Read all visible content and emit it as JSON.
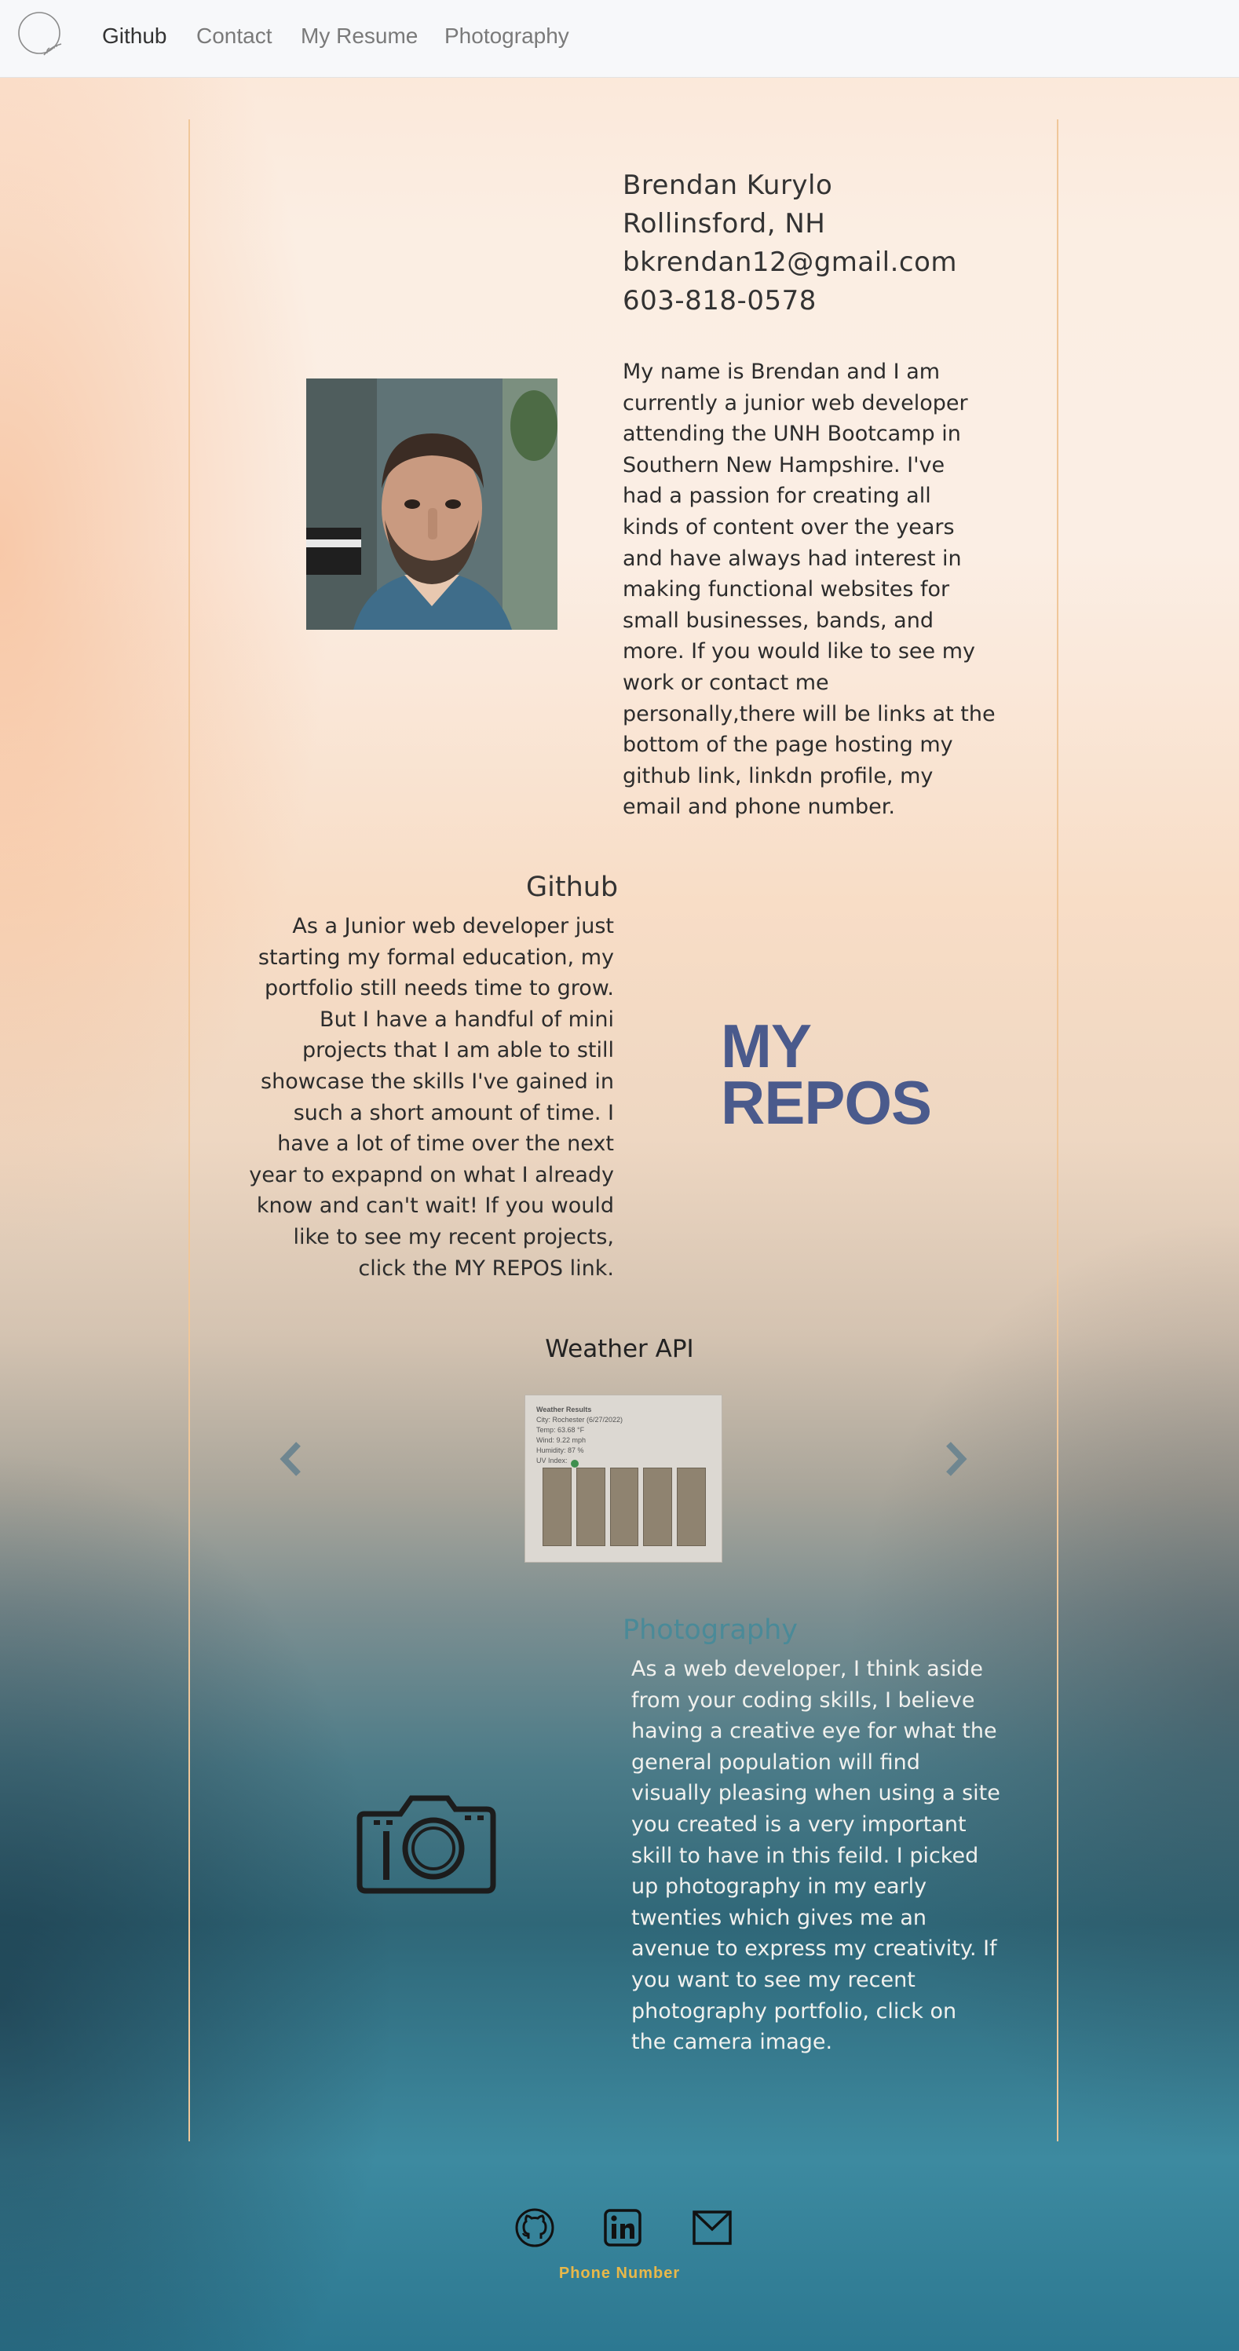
{
  "nav": {
    "items": [
      {
        "label": "Github",
        "active": true
      },
      {
        "label": "Contact",
        "active": false
      },
      {
        "label": "My Resume",
        "active": false
      },
      {
        "label": "Photography",
        "active": false
      }
    ]
  },
  "profile": {
    "name": "Brendan Kurylo",
    "location": "Rollinsford, NH",
    "email": "bkrendan12@gmail.com",
    "phone": "603-818-0578",
    "bio_lines": [
      "My name is Brendan and I am",
      "currently a junior web developer",
      "attending the UNH Bootcamp in",
      "Southern New Hampshire. I've",
      "had a passion for creating all",
      "kinds of content over the years",
      "and have always had interest in",
      "making functional websites for",
      "small businesses, bands, and",
      "more. If you would like to see my",
      "work or contact me",
      "personally,there will be links at the",
      "bottom of the page hosting my",
      "github link, linkdn profile, my",
      "email and phone number."
    ]
  },
  "github": {
    "title": "Github",
    "text_lines": [
      "As a Junior web developer just",
      "starting my formal education, my",
      "portfolio still needs time to grow.",
      "But I have a handful of mini",
      "projects that I am able to still",
      "showcase the skills I've gained in",
      "such a short amount of time. I",
      "have a lot of time over the next",
      "year to expapnd on what I already",
      "know and can't wait! If you would",
      "like to see my recent projects,",
      "click the MY REPOS link."
    ],
    "repos_line1": "MY",
    "repos_line2": "REPOS",
    "repos_color": "#4a5a8c"
  },
  "carousel": {
    "title": "Weather API",
    "prev_icon": "chevron-left-icon",
    "next_icon": "chevron-right-icon",
    "slide": {
      "heading": "Weather Results",
      "lines": [
        "City: Rochester (6/27/2022)",
        "Temp: 63.68 °F",
        "Wind: 9.22 mph",
        "Humidity: 87 %",
        "UV Index:"
      ]
    }
  },
  "photography": {
    "title": "Photography",
    "title_color": "#4a8a98",
    "text_lines": [
      "As a web developer, I think aside",
      "from your coding skills, I believe",
      "having a creative eye for what the",
      "general population will find",
      "visually pleasing when using a site",
      "you created is a very important",
      "skill to have in this feild. I picked",
      "up photography in my early",
      "twenties which gives me an",
      "avenue to express my creativity. If",
      "you want to see my recent",
      "photography portfolio, click on",
      "the camera image."
    ],
    "camera_icon": "camera-icon"
  },
  "footer": {
    "icons": [
      "github-icon",
      "linkedin-icon",
      "mail-icon"
    ],
    "phone_label": "Phone Number",
    "phone_color": "#e8b84a"
  }
}
